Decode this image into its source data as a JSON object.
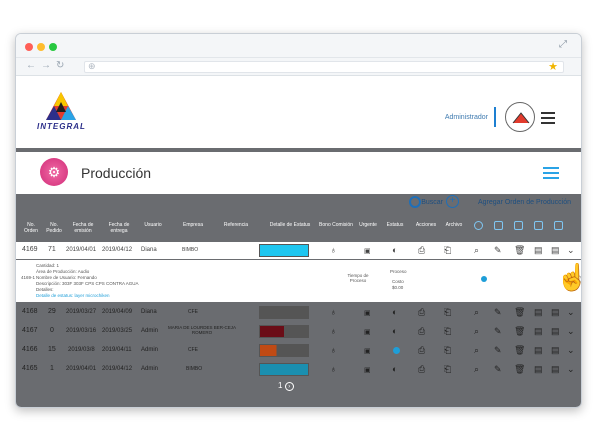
{
  "browser": {
    "dots": [
      "#ff5f57",
      "#febc2e",
      "#28c840"
    ]
  },
  "header": {
    "logo_text": "INTEGRAL",
    "admin_label": "Administrador"
  },
  "page": {
    "title": "Producción"
  },
  "toolbar": {
    "search_label": "Buscar",
    "add_label": "Agregar Orden de Producción"
  },
  "table": {
    "columns": [
      "No. Orden",
      "No. Pedido",
      "Fecha de emisión",
      "Fecha de entrega",
      "Usuario",
      "Empresa",
      "Referencia",
      "Detalle de Estatus",
      "Bono Comisión",
      "Urgente",
      "Estatus",
      "Acciones",
      "Archivo"
    ],
    "rows": [
      {
        "orden": "4169",
        "pedido": "71",
        "emision": "2019/04/01",
        "entrega": "2019/04/12",
        "usuario": "Diana",
        "empresa": "BIMBO",
        "status_colors": [
          "#1ec6f0"
        ],
        "status_dot": "#ffffff"
      },
      {
        "orden": "4168",
        "pedido": "29",
        "emision": "2019/03/27",
        "entrega": "2019/04/09",
        "usuario": "Diana",
        "empresa": "CFE",
        "status_colors": [
          "#555555"
        ],
        "status_dot": "#888888"
      },
      {
        "orden": "4167",
        "pedido": "0",
        "emision": "2019/03/16",
        "entrega": "2019/03/25",
        "usuario": "Admin",
        "empresa": "MARIA DE LOURDES BER-CEJA ROMERO",
        "status_colors": [
          "#6b0d17",
          "#555555",
          "#555555"
        ],
        "status_dot": "#888888"
      },
      {
        "orden": "4166",
        "pedido": "15",
        "emision": "2019/03/8",
        "entrega": "2019/04/11",
        "usuario": "Admin",
        "empresa": "CFE",
        "status_colors": [
          "#c04a14",
          "#555555",
          "#555555"
        ],
        "status_dot": "#1e9ed8"
      },
      {
        "orden": "4165",
        "pedido": "1",
        "emision": "2019/04/01",
        "entrega": "2019/04/12",
        "usuario": "Admin",
        "empresa": "BIMBO",
        "status_colors": [
          "#1ec6f0"
        ],
        "status_dot": "#888888"
      }
    ]
  },
  "detail": {
    "orden": "4169-1",
    "cantidad": "Cantidad: 1",
    "area": "Área de Producción: Audio",
    "usuario": "Nombre de Usuario: Fernando",
    "descripcion": "Descripción: 303F 303F CPS CPS CONTRA AGUA",
    "detalles": "Detalles:",
    "link": "Detalle de estatus: layer microchiken",
    "tiempo_label": "Tiempo de Proceso",
    "proceso_label": "Proceso",
    "costo_label": "Costo",
    "costo_value": "$0.00"
  },
  "pagination": {
    "current": "1"
  }
}
